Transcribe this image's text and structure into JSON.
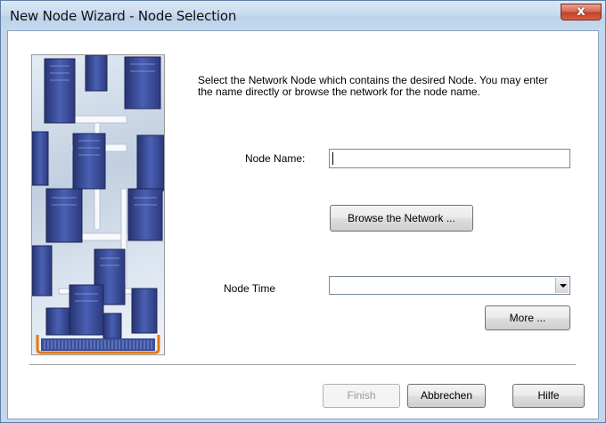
{
  "window": {
    "title": "New Node Wizard - Node Selection",
    "close_glyph": "x"
  },
  "illustration": {
    "icon": "network-servers-icon"
  },
  "instructions": "Select the Network Node which contains the desired Node.  You may enter the name directly or browse the network for the node name.",
  "node_name": {
    "label": "Node Name:",
    "value": ""
  },
  "browse_label": "Browse the Network ...",
  "node_time": {
    "label": "Node Time",
    "value": ""
  },
  "more_label": "More ...",
  "footer": {
    "finish_label": "Finish",
    "cancel_label": "Abbrechen",
    "help_label": "Hilfe"
  },
  "colors": {
    "server_blue": "#3d4f9e",
    "frame_orange": "#e07a10"
  }
}
